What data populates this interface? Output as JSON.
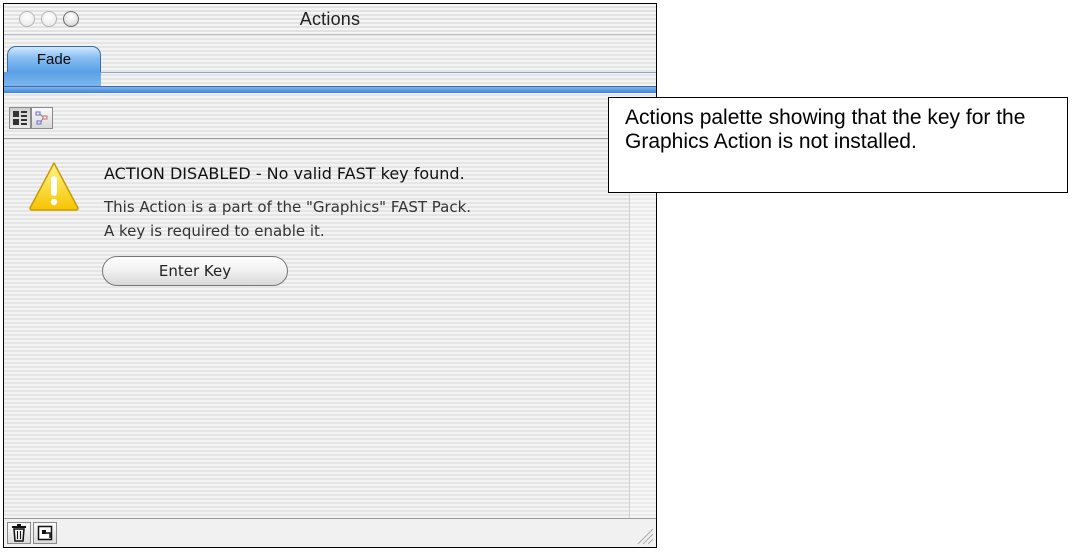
{
  "window": {
    "title": "Actions"
  },
  "tabs": [
    {
      "label": "Fade"
    }
  ],
  "toolbar": {
    "icons": [
      "list-view-icon",
      "flow-view-icon"
    ]
  },
  "message": {
    "icon": "warning-icon",
    "title": "ACTION DISABLED - No valid FAST key found.",
    "line1": "This Action is a part of the \"Graphics\" FAST Pack.",
    "line2": "A key is required to enable it."
  },
  "enter_key_button": {
    "label": "Enter Key"
  },
  "bottom_bar": {
    "icons": [
      "trash-icon",
      "new-item-icon"
    ]
  },
  "callout": {
    "text": "Actions palette showing that the key for the Graphics Action is not installed."
  },
  "colors": {
    "tab_accent": "#5aa0e6",
    "warning_yellow": "#f6c500"
  }
}
